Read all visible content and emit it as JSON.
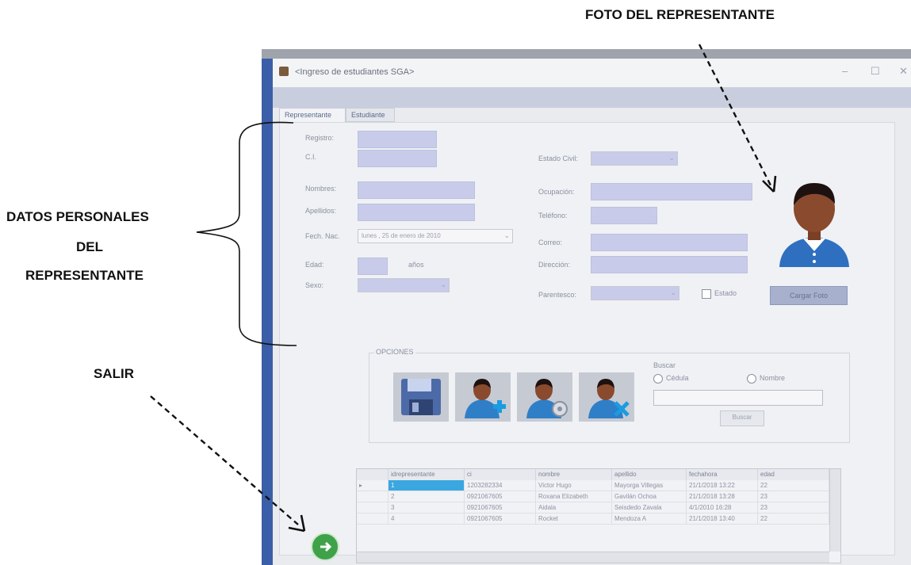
{
  "annotations": {
    "foto": "FOTO DEL REPRESENTANTE",
    "datos_line1": "DATOS PERSONALES",
    "datos_line2": "DEL",
    "datos_line3": "REPRESENTANTE",
    "salir": "SALIR"
  },
  "window": {
    "title": "<Ingreso de estudiantes SGA>",
    "min": "–",
    "max": "☐",
    "close": "✕"
  },
  "tabs": [
    "Representante",
    "Estudiante"
  ],
  "form": {
    "registro": "Registro:",
    "ci": "C.I.",
    "nombres": "Nombres:",
    "apellidos": "Apellidos:",
    "fech_nac": "Fech. Nac.",
    "fecha_value": "lunes , 25 de enero de 2010",
    "edad": "Edad:",
    "anios": "años",
    "sexo": "Sexo:",
    "estado_civil": "Estado Civil:",
    "ocupacion": "Ocupación:",
    "telefono": "Teléfono:",
    "correo": "Correo:",
    "direccion": "Dirección:",
    "parentesco": "Parentesco:",
    "estado_chk": "Estado",
    "cargar_foto": "Cargar Foto"
  },
  "opciones": {
    "label": "OPCIONES",
    "buscar_group": "Buscar",
    "cedula": "Cédula",
    "nombre": "Nombre",
    "buscar_btn": "Buscar"
  },
  "grid": {
    "columns": [
      "idrepresentante",
      "ci",
      "nombre",
      "apellido",
      "fechahora",
      "edad"
    ],
    "rows": [
      [
        "1",
        "1203282334",
        "Victor Hugo",
        "Mayorga Villegas",
        "21/1/2018 13:22",
        "22"
      ],
      [
        "2",
        "0921067605",
        "Roxana Elizabeth",
        "Gavilán Ochoa",
        "21/1/2018 13:28",
        "23"
      ],
      [
        "3",
        "0921067605",
        "Aidala",
        "Seisdedo Zavala",
        "4/1/2010 16:28",
        "23"
      ],
      [
        "4",
        "0921067605",
        "Rocket",
        "Mendoza A",
        "21/1/2018 13:40",
        "22"
      ]
    ]
  },
  "colors": {
    "field": "#c9cbea",
    "accent_blue": "#2f6fc0",
    "avatar_skin": "#8a4a2e"
  }
}
